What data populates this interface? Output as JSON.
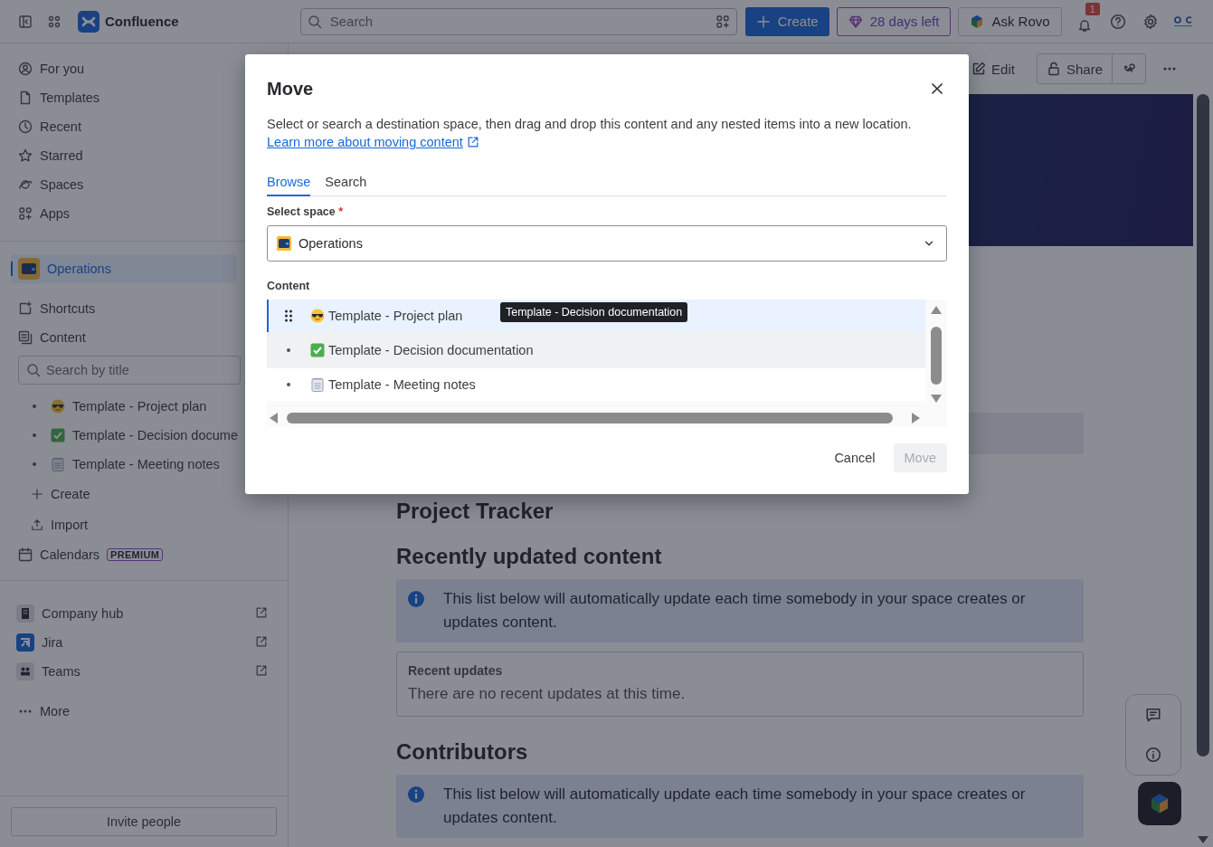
{
  "topbar": {
    "product": "Confluence",
    "search_placeholder": "Search",
    "create": "Create",
    "trial": "28 days left",
    "ask": "Ask Rovo",
    "notification_count": "1"
  },
  "sidebar": {
    "nav": [
      {
        "label": "For you",
        "kind": "person"
      },
      {
        "label": "Templates",
        "kind": "document"
      },
      {
        "label": "Recent",
        "kind": "clock"
      },
      {
        "label": "Starred",
        "kind": "star"
      },
      {
        "label": "Spaces",
        "kind": "planet"
      },
      {
        "label": "Apps",
        "kind": "apps"
      }
    ],
    "space": {
      "name": "Operations",
      "selected": true
    },
    "space_items": [
      {
        "label": "Shortcuts",
        "kind": "shortcut"
      },
      {
        "label": "Content",
        "kind": "content"
      }
    ],
    "search_placeholder": "Search by title",
    "pages": [
      {
        "title": "Template - Project plan",
        "kind": "sunglasses"
      },
      {
        "title": "Template - Decision docume",
        "kind": "check"
      },
      {
        "title": "Template - Meeting notes",
        "kind": "notepad"
      }
    ],
    "actions": [
      {
        "label": "Create",
        "kind": "plus"
      },
      {
        "label": "Import",
        "kind": "upload"
      }
    ],
    "calendars": {
      "label": "Calendars",
      "badge": "PREMIUM"
    },
    "apps": [
      {
        "label": "Company hub",
        "kind": "building"
      },
      {
        "label": "Jira",
        "kind": "jira"
      },
      {
        "label": "Teams",
        "kind": "teams"
      }
    ],
    "more": "More",
    "invite": "Invite people"
  },
  "page": {
    "toolbar": {
      "edit": "Edit",
      "share": "Share"
    },
    "heading": "Project Tracker",
    "sections": [
      {
        "title": "Recently updated content",
        "info": "This list below will automatically update each time somebody in your space creates or updates content.",
        "card_title": "Recent updates",
        "card_text": "There are no recent updates at this time."
      },
      {
        "title": "Contributors",
        "info": "This list below will automatically update each time somebody in your space creates or updates content."
      }
    ]
  },
  "dialog": {
    "title": "Move",
    "description": "Select or search a destination space, then drag and drop this content and any nested items into a new location.",
    "link": "Learn more about moving content",
    "tabs": [
      {
        "label": "Browse",
        "selected": true
      },
      {
        "label": "Search",
        "selected": false
      }
    ],
    "space_label": "Select space",
    "required_mark": "*",
    "space_value": "Operations",
    "content_label": "Content",
    "rows": [
      {
        "title": "Template - Project plan",
        "kind": "sunglasses",
        "selected": true,
        "highlighted": false
      },
      {
        "title": "Template - Decision documentation",
        "kind": "check",
        "selected": false,
        "highlighted": true
      },
      {
        "title": "Template - Meeting notes",
        "kind": "notepad",
        "selected": false,
        "highlighted": false
      }
    ],
    "tooltip": "Template - Decision documentation",
    "cancel": "Cancel",
    "move": {
      "label": "Move",
      "disabled": true
    }
  }
}
